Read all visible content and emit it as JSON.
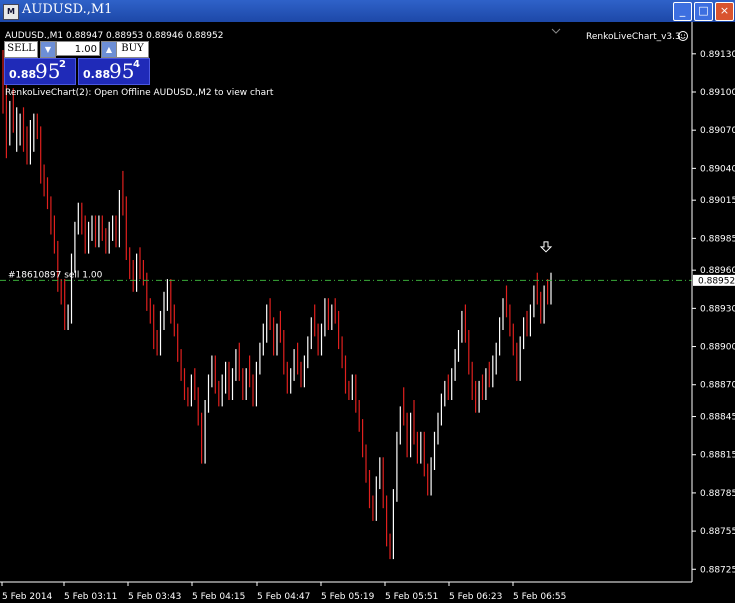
{
  "window": {
    "title": "AUDUSD.,M1",
    "icon_name": "mt4-chart-icon",
    "controls": [
      "_",
      "□",
      "×"
    ]
  },
  "chart_info": "AUDUSD.,M1  0.88947 0.88953 0.88946 0.88952",
  "indicator_name": "RenkoLiveChart_v3.3",
  "indicator_message": "RenkoLiveChart(2): Open Offline AUDUSD.,M2 to view chart",
  "trade_panel": {
    "sell_label": "SELL",
    "buy_label": "BUY",
    "lot_value": "1.00",
    "sell_price_prefix": "0.88",
    "sell_price_big": "95",
    "sell_price_sup": "2",
    "buy_price_prefix": "0.88",
    "buy_price_big": "95",
    "buy_price_sup": "4"
  },
  "order_label": "#18610897 sell 1.00",
  "current_price_label": "0.88952",
  "colors": {
    "background": "#000000",
    "bull_candle": "#ffffff",
    "bear_candle": "#e0201e",
    "order_line": "#3aaa3a",
    "axis": "#ffffff"
  },
  "chart_data": {
    "type": "bar",
    "symbol": "AUDUSD.",
    "timeframe": "M1",
    "ylim": [
      0.88715,
      0.89155
    ],
    "y_ticks": [
      "0.89130",
      "0.89100",
      "0.89070",
      "0.89040",
      "0.89015",
      "0.88985",
      "0.88960",
      "0.88930",
      "0.88900",
      "0.88870",
      "0.88845",
      "0.88815",
      "0.88785",
      "0.88755",
      "0.88725"
    ],
    "x_ticks": [
      "5 Feb 2014",
      "5 Feb 03:11",
      "5 Feb 03:43",
      "5 Feb 04:15",
      "5 Feb 04:47",
      "5 Feb 05:19",
      "5 Feb 05:51",
      "5 Feb 06:23",
      "5 Feb 06:55"
    ],
    "order_price": 0.88952,
    "current_price": 0.88952,
    "marker_price": 0.88965,
    "ohlc": [
      [
        0.89103,
        0.89133,
        0.89083,
        0.89093
      ],
      [
        0.89093,
        0.89108,
        0.89048,
        0.89063
      ],
      [
        0.89063,
        0.89093,
        0.89058,
        0.89088
      ],
      [
        0.89088,
        0.89103,
        0.89068,
        0.89068
      ],
      [
        0.89068,
        0.89088,
        0.89053,
        0.89073
      ],
      [
        0.89073,
        0.89083,
        0.89058,
        0.89078
      ],
      [
        0.89078,
        0.89088,
        0.89053,
        0.89058
      ],
      [
        0.89058,
        0.89073,
        0.89043,
        0.89048
      ],
      [
        0.89048,
        0.89078,
        0.89043,
        0.89063
      ],
      [
        0.89063,
        0.89083,
        0.89053,
        0.89078
      ],
      [
        0.89078,
        0.89083,
        0.89063,
        0.89068
      ],
      [
        0.89068,
        0.89073,
        0.89028,
        0.89033
      ],
      [
        0.89033,
        0.89043,
        0.89018,
        0.89023
      ],
      [
        0.89023,
        0.89033,
        0.89008,
        0.89013
      ],
      [
        0.89013,
        0.89018,
        0.88988,
        0.88993
      ],
      [
        0.88993,
        0.89003,
        0.88973,
        0.88978
      ],
      [
        0.88978,
        0.88983,
        0.88943,
        0.88948
      ],
      [
        0.88948,
        0.88953,
        0.88933,
        0.88938
      ],
      [
        0.88938,
        0.88953,
        0.88913,
        0.88918
      ],
      [
        0.88918,
        0.88933,
        0.88913,
        0.88923
      ],
      [
        0.88923,
        0.88973,
        0.88918,
        0.88963
      ],
      [
        0.88963,
        0.88998,
        0.88958,
        0.88993
      ],
      [
        0.88993,
        0.89013,
        0.88988,
        0.89008
      ],
      [
        0.89008,
        0.89013,
        0.88988,
        0.88993
      ],
      [
        0.88993,
        0.89003,
        0.88973,
        0.88978
      ],
      [
        0.88978,
        0.88998,
        0.88973,
        0.88993
      ],
      [
        0.88993,
        0.89003,
        0.88983,
        0.88998
      ],
      [
        0.88998,
        0.89003,
        0.88978,
        0.88983
      ],
      [
        0.88983,
        0.89003,
        0.88978,
        0.88998
      ],
      [
        0.88998,
        0.89003,
        0.88983,
        0.88988
      ],
      [
        0.88988,
        0.88993,
        0.88973,
        0.88978
      ],
      [
        0.88978,
        0.88998,
        0.88973,
        0.88993
      ],
      [
        0.88993,
        0.89003,
        0.88983,
        0.88998
      ],
      [
        0.88998,
        0.89003,
        0.88978,
        0.88983
      ],
      [
        0.88983,
        0.89023,
        0.88978,
        0.89018
      ],
      [
        0.89018,
        0.89038,
        0.89003,
        0.89013
      ],
      [
        0.89013,
        0.89018,
        0.88968,
        0.88973
      ],
      [
        0.88973,
        0.88978,
        0.88953,
        0.88958
      ],
      [
        0.88958,
        0.88968,
        0.88943,
        0.88948
      ],
      [
        0.88948,
        0.88973,
        0.88943,
        0.88968
      ],
      [
        0.88968,
        0.88978,
        0.88953,
        0.88958
      ],
      [
        0.88958,
        0.88968,
        0.88948,
        0.88953
      ],
      [
        0.88953,
        0.88958,
        0.88928,
        0.88933
      ],
      [
        0.88933,
        0.88938,
        0.88918,
        0.88923
      ],
      [
        0.88923,
        0.88933,
        0.88898,
        0.88903
      ],
      [
        0.88903,
        0.88913,
        0.88893,
        0.88898
      ],
      [
        0.88898,
        0.88928,
        0.88893,
        0.88923
      ],
      [
        0.88923,
        0.88943,
        0.88913,
        0.88938
      ],
      [
        0.88938,
        0.88953,
        0.88928,
        0.88948
      ],
      [
        0.88948,
        0.88953,
        0.88918,
        0.88923
      ],
      [
        0.88923,
        0.88933,
        0.88908,
        0.88913
      ],
      [
        0.88913,
        0.88918,
        0.88888,
        0.88893
      ],
      [
        0.88893,
        0.88898,
        0.88873,
        0.88878
      ],
      [
        0.88878,
        0.88883,
        0.88858,
        0.88863
      ],
      [
        0.88863,
        0.88868,
        0.88853,
        0.88858
      ],
      [
        0.88858,
        0.88878,
        0.88853,
        0.88873
      ],
      [
        0.88873,
        0.88883,
        0.88858,
        0.88863
      ],
      [
        0.88863,
        0.88868,
        0.88838,
        0.88843
      ],
      [
        0.88843,
        0.88848,
        0.88808,
        0.88813
      ],
      [
        0.88813,
        0.88858,
        0.88808,
        0.88853
      ],
      [
        0.88853,
        0.88878,
        0.88848,
        0.88873
      ],
      [
        0.88873,
        0.88893,
        0.88868,
        0.88888
      ],
      [
        0.88888,
        0.88893,
        0.88863,
        0.88868
      ],
      [
        0.88868,
        0.88873,
        0.88853,
        0.88858
      ],
      [
        0.88858,
        0.88878,
        0.88853,
        0.88873
      ],
      [
        0.88873,
        0.88888,
        0.88863,
        0.88883
      ],
      [
        0.88883,
        0.88888,
        0.88858,
        0.88863
      ],
      [
        0.88863,
        0.88883,
        0.88858,
        0.88878
      ],
      [
        0.88878,
        0.88898,
        0.88873,
        0.88893
      ],
      [
        0.88893,
        0.88903,
        0.88873,
        0.88878
      ],
      [
        0.88878,
        0.88883,
        0.88858,
        0.88863
      ],
      [
        0.88863,
        0.88883,
        0.88858,
        0.88878
      ],
      [
        0.88878,
        0.88893,
        0.88868,
        0.88873
      ],
      [
        0.88873,
        0.88878,
        0.88853,
        0.88858
      ],
      [
        0.88858,
        0.88888,
        0.88853,
        0.88883
      ],
      [
        0.88883,
        0.88903,
        0.88878,
        0.88898
      ],
      [
        0.88898,
        0.88918,
        0.88893,
        0.88913
      ],
      [
        0.88913,
        0.88933,
        0.88903,
        0.88928
      ],
      [
        0.88928,
        0.88938,
        0.88913,
        0.88918
      ],
      [
        0.88918,
        0.88923,
        0.88893,
        0.88898
      ],
      [
        0.88898,
        0.88918,
        0.88893,
        0.88913
      ],
      [
        0.88913,
        0.88928,
        0.88903,
        0.88908
      ],
      [
        0.88908,
        0.88913,
        0.88878,
        0.88883
      ],
      [
        0.88883,
        0.88888,
        0.88863,
        0.88868
      ],
      [
        0.88868,
        0.88883,
        0.88863,
        0.88878
      ],
      [
        0.88878,
        0.88898,
        0.88873,
        0.88893
      ],
      [
        0.88893,
        0.88903,
        0.88878,
        0.88883
      ],
      [
        0.88883,
        0.88888,
        0.88868,
        0.88873
      ],
      [
        0.88873,
        0.88893,
        0.88868,
        0.88888
      ],
      [
        0.88888,
        0.88908,
        0.88883,
        0.88903
      ],
      [
        0.88903,
        0.88923,
        0.88898,
        0.88918
      ],
      [
        0.88918,
        0.88933,
        0.88908,
        0.88913
      ],
      [
        0.88913,
        0.88918,
        0.88893,
        0.88898
      ],
      [
        0.88898,
        0.88918,
        0.88893,
        0.88913
      ],
      [
        0.88913,
        0.88938,
        0.88908,
        0.88933
      ],
      [
        0.88933,
        0.88938,
        0.88913,
        0.88918
      ],
      [
        0.88918,
        0.88933,
        0.88913,
        0.88928
      ],
      [
        0.88928,
        0.88938,
        0.88918,
        0.88923
      ],
      [
        0.88923,
        0.88928,
        0.88898,
        0.88903
      ],
      [
        0.88903,
        0.88908,
        0.88883,
        0.88888
      ],
      [
        0.88888,
        0.88893,
        0.88863,
        0.88868
      ],
      [
        0.88868,
        0.88873,
        0.88858,
        0.88863
      ],
      [
        0.88863,
        0.88878,
        0.88858,
        0.88873
      ],
      [
        0.88873,
        0.88878,
        0.88848,
        0.88853
      ],
      [
        0.88853,
        0.88858,
        0.88833,
        0.88838
      ],
      [
        0.88838,
        0.88843,
        0.88813,
        0.88818
      ],
      [
        0.88818,
        0.88823,
        0.88793,
        0.88798
      ],
      [
        0.88798,
        0.88803,
        0.88773,
        0.88778
      ],
      [
        0.88778,
        0.88783,
        0.88763,
        0.88768
      ],
      [
        0.88768,
        0.88798,
        0.88763,
        0.88793
      ],
      [
        0.88793,
        0.88813,
        0.88788,
        0.88808
      ],
      [
        0.88808,
        0.88813,
        0.88773,
        0.88778
      ],
      [
        0.88778,
        0.88783,
        0.88743,
        0.88748
      ],
      [
        0.88748,
        0.88753,
        0.88733,
        0.88738
      ],
      [
        0.88738,
        0.88788,
        0.88733,
        0.88783
      ],
      [
        0.88783,
        0.88833,
        0.88778,
        0.88828
      ],
      [
        0.88828,
        0.88853,
        0.88823,
        0.88848
      ],
      [
        0.88848,
        0.88868,
        0.88838,
        0.88843
      ],
      [
        0.88843,
        0.88848,
        0.88813,
        0.88818
      ],
      [
        0.88818,
        0.88848,
        0.88813,
        0.88843
      ],
      [
        0.88843,
        0.88858,
        0.88823,
        0.88828
      ],
      [
        0.88828,
        0.88833,
        0.88808,
        0.88813
      ],
      [
        0.88813,
        0.88833,
        0.88808,
        0.88828
      ],
      [
        0.88828,
        0.88833,
        0.88798,
        0.88803
      ],
      [
        0.88803,
        0.88808,
        0.88783,
        0.88788
      ],
      [
        0.88788,
        0.88813,
        0.88783,
        0.88808
      ],
      [
        0.88808,
        0.88833,
        0.88803,
        0.88828
      ],
      [
        0.88828,
        0.88848,
        0.88823,
        0.88843
      ],
      [
        0.88843,
        0.88863,
        0.88838,
        0.88858
      ],
      [
        0.88858,
        0.88873,
        0.88853,
        0.88868
      ],
      [
        0.88868,
        0.88878,
        0.88858,
        0.88863
      ],
      [
        0.88863,
        0.88883,
        0.88858,
        0.88878
      ],
      [
        0.88878,
        0.88898,
        0.88873,
        0.88893
      ],
      [
        0.88893,
        0.88913,
        0.88888,
        0.88908
      ],
      [
        0.88908,
        0.88928,
        0.88903,
        0.88923
      ],
      [
        0.88923,
        0.88933,
        0.88903,
        0.88908
      ],
      [
        0.88908,
        0.88913,
        0.88878,
        0.88883
      ],
      [
        0.88883,
        0.88888,
        0.88858,
        0.88863
      ],
      [
        0.88863,
        0.88873,
        0.88848,
        0.88853
      ],
      [
        0.88853,
        0.88873,
        0.88848,
        0.88868
      ],
      [
        0.88868,
        0.88878,
        0.88858,
        0.88863
      ],
      [
        0.88863,
        0.88883,
        0.88858,
        0.88878
      ],
      [
        0.88878,
        0.88888,
        0.88868,
        0.88873
      ],
      [
        0.88873,
        0.88893,
        0.88868,
        0.88888
      ],
      [
        0.88888,
        0.88903,
        0.88878,
        0.88898
      ],
      [
        0.88898,
        0.88923,
        0.88893,
        0.88918
      ],
      [
        0.88918,
        0.88938,
        0.88913,
        0.88933
      ],
      [
        0.88933,
        0.88948,
        0.88923,
        0.88928
      ],
      [
        0.88928,
        0.88933,
        0.88908,
        0.88913
      ],
      [
        0.88913,
        0.88918,
        0.88893,
        0.88898
      ],
      [
        0.88898,
        0.88903,
        0.88873,
        0.88878
      ],
      [
        0.88878,
        0.88908,
        0.88873,
        0.88903
      ],
      [
        0.88903,
        0.88923,
        0.88898,
        0.88918
      ],
      [
        0.88918,
        0.88928,
        0.88908,
        0.88913
      ],
      [
        0.88913,
        0.88933,
        0.88908,
        0.88928
      ],
      [
        0.88928,
        0.88948,
        0.88923,
        0.88943
      ],
      [
        0.88943,
        0.88958,
        0.88933,
        0.88938
      ],
      [
        0.88938,
        0.88943,
        0.88918,
        0.88923
      ],
      [
        0.88923,
        0.88948,
        0.88918,
        0.88943
      ],
      [
        0.88943,
        0.88953,
        0.88933,
        0.88938
      ],
      [
        0.88938,
        0.88958,
        0.88933,
        0.88953
      ]
    ]
  }
}
